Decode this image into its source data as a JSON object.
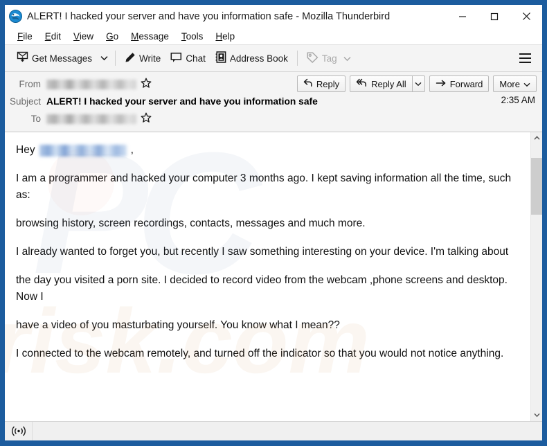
{
  "window": {
    "title": "ALERT! I hacked your server and have you information safe - Mozilla Thunderbird",
    "app_icon": "thunderbird-icon",
    "minimize_label": "─",
    "maximize_label": "□",
    "close_label": "✕",
    "border_color": "#1c5c9e"
  },
  "menubar": {
    "items": [
      {
        "label": "File",
        "accesskey": "F"
      },
      {
        "label": "Edit",
        "accesskey": "E"
      },
      {
        "label": "View",
        "accesskey": "V"
      },
      {
        "label": "Go",
        "accesskey": "G"
      },
      {
        "label": "Message",
        "accesskey": "M"
      },
      {
        "label": "Tools",
        "accesskey": "T"
      },
      {
        "label": "Help",
        "accesskey": "H"
      }
    ]
  },
  "toolbar": {
    "get_messages_label": "Get Messages",
    "write_label": "Write",
    "chat_label": "Chat",
    "address_book_label": "Address Book",
    "tag_label": "Tag",
    "tag_disabled": true,
    "app_menu_label": "Application Menu"
  },
  "message_header": {
    "from_label": "From",
    "from_value": "",
    "subject_label": "Subject",
    "subject_value": "ALERT! I hacked your server and have you information safe",
    "to_label": "To",
    "to_value": "",
    "time": "2:35 AM",
    "actions": {
      "reply_label": "Reply",
      "reply_all_label": "Reply All",
      "forward_label": "Forward",
      "more_label": "More"
    }
  },
  "message_body": {
    "greeting_prefix": "Hey",
    "greeting_suffix": ",",
    "paragraphs": [
      "I am a programmer and hacked your computer 3 months ago. I kept saving information all the time, such as:",
      "browsing history, screen recordings, contacts, messages and much more.",
      "I already wanted to forget you, but recently I saw something interesting on your device. I'm talking about",
      "the day you visited a porn site. I decided to record video from the webcam ,phone screens and desktop. Now I",
      "have a video of you masturbating yourself. You know what I mean??",
      "I connected to the webcam remotely, and turned off the indicator so that you would not notice anything."
    ],
    "watermark_pc": "PC",
    "watermark_risk": "risk.com"
  },
  "statusbar": {
    "icon": "broadcast-icon",
    "text": ""
  }
}
